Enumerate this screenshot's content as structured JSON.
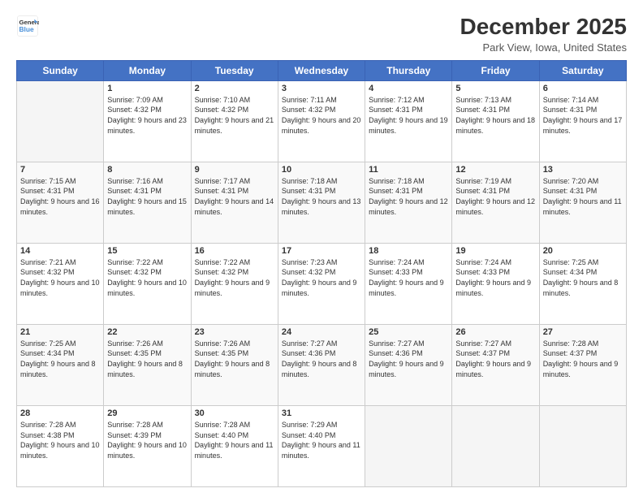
{
  "logo": {
    "line1": "General",
    "line2": "Blue"
  },
  "title": "December 2025",
  "subtitle": "Park View, Iowa, United States",
  "days_header": [
    "Sunday",
    "Monday",
    "Tuesday",
    "Wednesday",
    "Thursday",
    "Friday",
    "Saturday"
  ],
  "weeks": [
    [
      {
        "num": "",
        "empty": true
      },
      {
        "num": "1",
        "sunrise": "7:09 AM",
        "sunset": "4:32 PM",
        "daylight": "9 hours and 23 minutes."
      },
      {
        "num": "2",
        "sunrise": "7:10 AM",
        "sunset": "4:32 PM",
        "daylight": "9 hours and 21 minutes."
      },
      {
        "num": "3",
        "sunrise": "7:11 AM",
        "sunset": "4:32 PM",
        "daylight": "9 hours and 20 minutes."
      },
      {
        "num": "4",
        "sunrise": "7:12 AM",
        "sunset": "4:31 PM",
        "daylight": "9 hours and 19 minutes."
      },
      {
        "num": "5",
        "sunrise": "7:13 AM",
        "sunset": "4:31 PM",
        "daylight": "9 hours and 18 minutes."
      },
      {
        "num": "6",
        "sunrise": "7:14 AM",
        "sunset": "4:31 PM",
        "daylight": "9 hours and 17 minutes."
      }
    ],
    [
      {
        "num": "7",
        "sunrise": "7:15 AM",
        "sunset": "4:31 PM",
        "daylight": "9 hours and 16 minutes."
      },
      {
        "num": "8",
        "sunrise": "7:16 AM",
        "sunset": "4:31 PM",
        "daylight": "9 hours and 15 minutes."
      },
      {
        "num": "9",
        "sunrise": "7:17 AM",
        "sunset": "4:31 PM",
        "daylight": "9 hours and 14 minutes."
      },
      {
        "num": "10",
        "sunrise": "7:18 AM",
        "sunset": "4:31 PM",
        "daylight": "9 hours and 13 minutes."
      },
      {
        "num": "11",
        "sunrise": "7:18 AM",
        "sunset": "4:31 PM",
        "daylight": "9 hours and 12 minutes."
      },
      {
        "num": "12",
        "sunrise": "7:19 AM",
        "sunset": "4:31 PM",
        "daylight": "9 hours and 12 minutes."
      },
      {
        "num": "13",
        "sunrise": "7:20 AM",
        "sunset": "4:31 PM",
        "daylight": "9 hours and 11 minutes."
      }
    ],
    [
      {
        "num": "14",
        "sunrise": "7:21 AM",
        "sunset": "4:32 PM",
        "daylight": "9 hours and 10 minutes."
      },
      {
        "num": "15",
        "sunrise": "7:22 AM",
        "sunset": "4:32 PM",
        "daylight": "9 hours and 10 minutes."
      },
      {
        "num": "16",
        "sunrise": "7:22 AM",
        "sunset": "4:32 PM",
        "daylight": "9 hours and 9 minutes."
      },
      {
        "num": "17",
        "sunrise": "7:23 AM",
        "sunset": "4:32 PM",
        "daylight": "9 hours and 9 minutes."
      },
      {
        "num": "18",
        "sunrise": "7:24 AM",
        "sunset": "4:33 PM",
        "daylight": "9 hours and 9 minutes."
      },
      {
        "num": "19",
        "sunrise": "7:24 AM",
        "sunset": "4:33 PM",
        "daylight": "9 hours and 9 minutes."
      },
      {
        "num": "20",
        "sunrise": "7:25 AM",
        "sunset": "4:34 PM",
        "daylight": "9 hours and 8 minutes."
      }
    ],
    [
      {
        "num": "21",
        "sunrise": "7:25 AM",
        "sunset": "4:34 PM",
        "daylight": "9 hours and 8 minutes."
      },
      {
        "num": "22",
        "sunrise": "7:26 AM",
        "sunset": "4:35 PM",
        "daylight": "9 hours and 8 minutes."
      },
      {
        "num": "23",
        "sunrise": "7:26 AM",
        "sunset": "4:35 PM",
        "daylight": "9 hours and 8 minutes."
      },
      {
        "num": "24",
        "sunrise": "7:27 AM",
        "sunset": "4:36 PM",
        "daylight": "9 hours and 8 minutes."
      },
      {
        "num": "25",
        "sunrise": "7:27 AM",
        "sunset": "4:36 PM",
        "daylight": "9 hours and 9 minutes."
      },
      {
        "num": "26",
        "sunrise": "7:27 AM",
        "sunset": "4:37 PM",
        "daylight": "9 hours and 9 minutes."
      },
      {
        "num": "27",
        "sunrise": "7:28 AM",
        "sunset": "4:37 PM",
        "daylight": "9 hours and 9 minutes."
      }
    ],
    [
      {
        "num": "28",
        "sunrise": "7:28 AM",
        "sunset": "4:38 PM",
        "daylight": "9 hours and 10 minutes."
      },
      {
        "num": "29",
        "sunrise": "7:28 AM",
        "sunset": "4:39 PM",
        "daylight": "9 hours and 10 minutes."
      },
      {
        "num": "30",
        "sunrise": "7:28 AM",
        "sunset": "4:40 PM",
        "daylight": "9 hours and 11 minutes."
      },
      {
        "num": "31",
        "sunrise": "7:29 AM",
        "sunset": "4:40 PM",
        "daylight": "9 hours and 11 minutes."
      },
      {
        "num": "",
        "empty": true
      },
      {
        "num": "",
        "empty": true
      },
      {
        "num": "",
        "empty": true
      }
    ]
  ],
  "labels": {
    "sunrise": "Sunrise:",
    "sunset": "Sunset:",
    "daylight": "Daylight:"
  }
}
